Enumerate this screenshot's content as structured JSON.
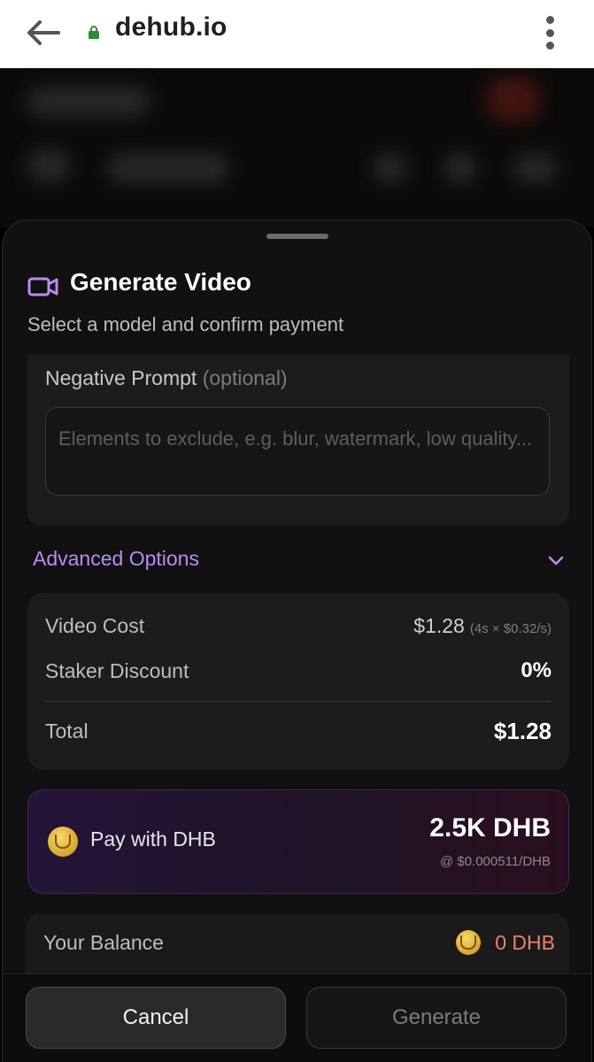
{
  "browser": {
    "url": "dehub.io"
  },
  "sheet": {
    "title": "Generate Video",
    "subtitle": "Select a model and confirm payment"
  },
  "negative_prompt": {
    "label": "Negative Prompt",
    "optional_label": "(optional)",
    "placeholder": "Elements to exclude, e.g. blur, watermark, low quality..."
  },
  "advanced": {
    "label": "Advanced Options"
  },
  "cost": {
    "video_cost_label": "Video Cost",
    "video_cost_value": "$1.28",
    "video_cost_detail": "(4s × $0.32/s)",
    "staker_discount_label": "Staker Discount",
    "staker_discount_value": "0%",
    "total_label": "Total",
    "total_value": "$1.28"
  },
  "payment": {
    "label": "Pay with DHB",
    "amount": "2.5K DHB",
    "rate": "@ $0.000511/DHB"
  },
  "balance": {
    "label": "Your Balance",
    "value": "0 DHB"
  },
  "actions": {
    "cancel": "Cancel",
    "generate": "Generate"
  },
  "colors": {
    "accent": "#b98cf2",
    "balance_warning": "#e8826e",
    "coin": "#e0b63a"
  }
}
